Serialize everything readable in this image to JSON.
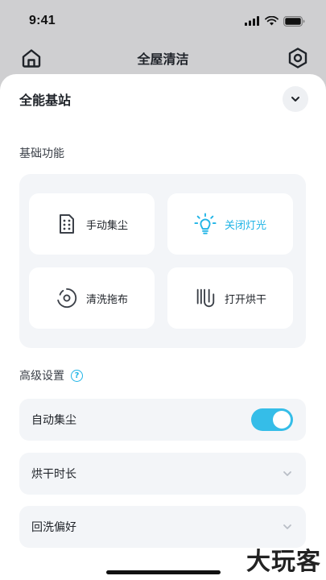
{
  "status_bar": {
    "time": "9:41"
  },
  "nav": {
    "title": "全屋清洁",
    "left_icon": "home-icon",
    "right_icon": "settings-icon"
  },
  "station": {
    "title": "全能基站",
    "collapse_icon": "chevron-down-icon"
  },
  "basic": {
    "title": "基础功能",
    "buttons": [
      {
        "label": "手动集尘",
        "icon": "dust-bin-icon",
        "active": false
      },
      {
        "label": "关闭灯光",
        "icon": "light-bulb-icon",
        "active": true
      },
      {
        "label": "清洗拖布",
        "icon": "mop-wash-icon",
        "active": false
      },
      {
        "label": "打开烘干",
        "icon": "heat-dry-icon",
        "active": false
      }
    ]
  },
  "advanced": {
    "title": "高级设置",
    "help_icon_text": "?",
    "rows": [
      {
        "label": "自动集尘",
        "control": "toggle",
        "on": true
      },
      {
        "label": "烘干时长",
        "control": "chevron"
      },
      {
        "label": "回洗偏好",
        "control": "chevron"
      }
    ]
  },
  "colors": {
    "accent": "#35bde8",
    "panel": "#f3f5f8",
    "header_bg": "#cfcfd1"
  },
  "watermark": "大玩客"
}
